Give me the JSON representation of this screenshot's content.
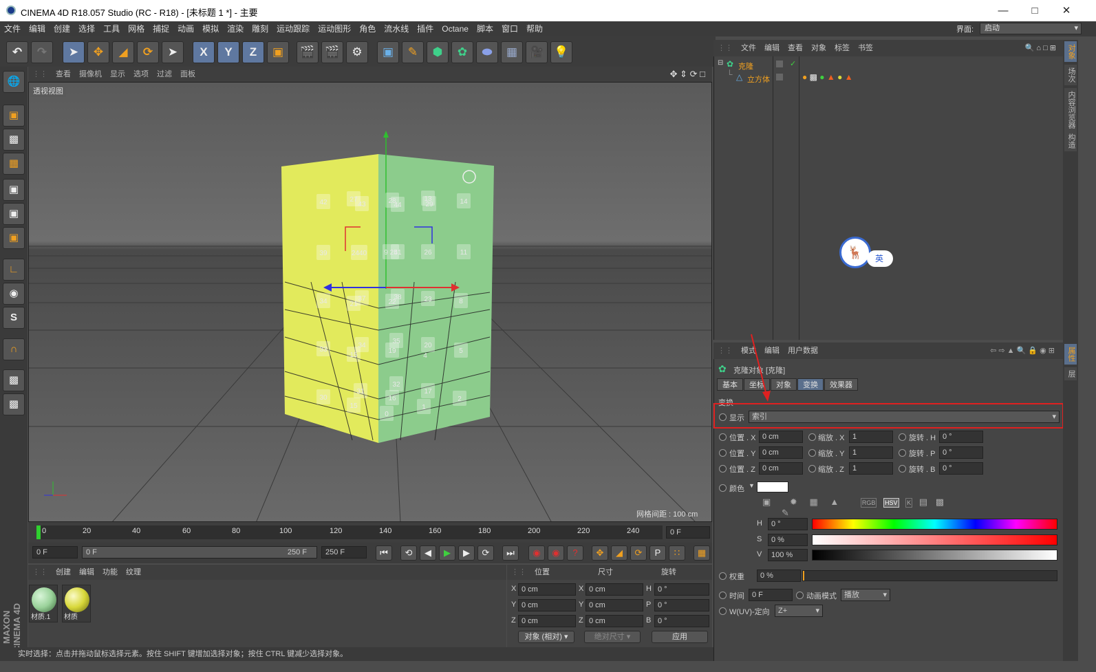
{
  "title_bar": {
    "title": "CINEMA 4D R18.057 Studio (RC - R18) - [未标题 1 *] - 主要"
  },
  "menu": [
    "文件",
    "编辑",
    "创建",
    "选择",
    "工具",
    "网格",
    "捕捉",
    "动画",
    "模拟",
    "渲染",
    "雕刻",
    "运动跟踪",
    "运动图形",
    "角色",
    "流水线",
    "插件",
    "Octane",
    "脚本",
    "窗口",
    "帮助"
  ],
  "interface": {
    "label": "界面:",
    "value": "启动"
  },
  "toolbar": {
    "x": "X",
    "y": "Y",
    "z": "Z"
  },
  "viewport": {
    "menu": [
      "查看",
      "摄像机",
      "显示",
      "选项",
      "过滤",
      "面板"
    ],
    "label": "透视视图",
    "grid_spacing": "网格间距 : 100 cm",
    "left_indices": [
      "42",
      "27",
      "43",
      "39",
      "2440",
      "34",
      "21",
      "37",
      "33",
      "15",
      "34",
      "30",
      "31",
      "15"
    ],
    "right_indices": [
      "28",
      "44",
      "13",
      "29",
      "14",
      "9 25",
      "41",
      "26",
      "11",
      "38",
      "22",
      "23",
      "8",
      "35",
      "19",
      "20",
      "4",
      "5",
      "32",
      "16",
      "17",
      "2",
      "0",
      "1"
    ]
  },
  "timeline": {
    "ticks": [
      "0",
      "20",
      "40",
      "60",
      "80",
      "100",
      "120",
      "140",
      "160",
      "180",
      "200",
      "220",
      "240"
    ],
    "current_frame": "0 F",
    "start": "0 F",
    "range_start": "0 F",
    "range_end": "250 F",
    "end": "250 F"
  },
  "material_panel": {
    "menu": [
      "创建",
      "编辑",
      "功能",
      "纹理"
    ],
    "materials": [
      {
        "name": "材质.1",
        "color": "#9ad29a"
      },
      {
        "name": "材质",
        "color": "#d8d83a"
      }
    ]
  },
  "coord_panel": {
    "headers": [
      "位置",
      "尺寸",
      "旋转"
    ],
    "rows": [
      {
        "a": "X",
        "pos": "0 cm",
        "b": "X",
        "size": "0 cm",
        "c": "H",
        "rot": "0 °"
      },
      {
        "a": "Y",
        "pos": "0 cm",
        "b": "Y",
        "size": "0 cm",
        "c": "P",
        "rot": "0 °"
      },
      {
        "a": "Z",
        "pos": "0 cm",
        "b": "Z",
        "size": "0 cm",
        "c": "B",
        "rot": "0 °"
      }
    ],
    "mode": "对象 (相对)",
    "size_mode": "绝对尺寸",
    "apply": "应用"
  },
  "status": "实时选择：点击并拖动鼠标选择元素。按住 SHIFT 键增加选择对象；按住 CTRL 键减少选择对象。",
  "object_manager": {
    "menu": [
      "文件",
      "编辑",
      "查看",
      "对象",
      "标签",
      "书签"
    ],
    "objects": [
      {
        "name": "克隆"
      },
      {
        "name": "立方体"
      }
    ],
    "ime_badge": "英"
  },
  "right_tabs": [
    "对象",
    "场次",
    "内容浏览器",
    "构造"
  ],
  "right_tabs_lower": [
    "属性",
    "层"
  ],
  "attribute_manager": {
    "menu": [
      "模式",
      "编辑",
      "用户数据"
    ],
    "object_title": "克隆对象 [克隆]",
    "tabs": [
      "基本",
      "坐标",
      "对象",
      "变换",
      "效果器"
    ],
    "active_tab": "变换",
    "section": "变换",
    "display_label": "显示",
    "display_value": "索引",
    "transform_rows": [
      {
        "pos_label": "位置 . X",
        "pos": "0 cm",
        "scale_label": "缩放 . X",
        "scale": "1",
        "rot_label": "旋转 . H",
        "rot": "0 °"
      },
      {
        "pos_label": "位置 . Y",
        "pos": "0 cm",
        "scale_label": "缩放 . Y",
        "scale": "1",
        "rot_label": "旋转 . P",
        "rot": "0 °"
      },
      {
        "pos_label": "位置 . Z",
        "pos": "0 cm",
        "scale_label": "缩放 . Z",
        "scale": "1",
        "rot_label": "旋转 . B",
        "rot": "0 °"
      }
    ],
    "color_label": "颜色",
    "color_mode_buttons": [
      "RGB",
      "HSV",
      "K"
    ],
    "hsv": [
      {
        "label": "H",
        "value": "0 °"
      },
      {
        "label": "S",
        "value": "0 %"
      },
      {
        "label": "V",
        "value": "100 %"
      }
    ],
    "weight_label": "权重",
    "weight_value": "0 %",
    "time_label": "时间",
    "time_value": "0 F",
    "anim_mode_label": "动画模式",
    "anim_mode_value": "播放",
    "uv_label": "W(UV)-定向",
    "uv_value": "Z+"
  },
  "colors": {
    "accent": "#5a6f8c",
    "highlight": "#e02020",
    "orange": "#f09020",
    "yellow_face": "#e2ea5c",
    "green_face": "#8ccc8c"
  }
}
